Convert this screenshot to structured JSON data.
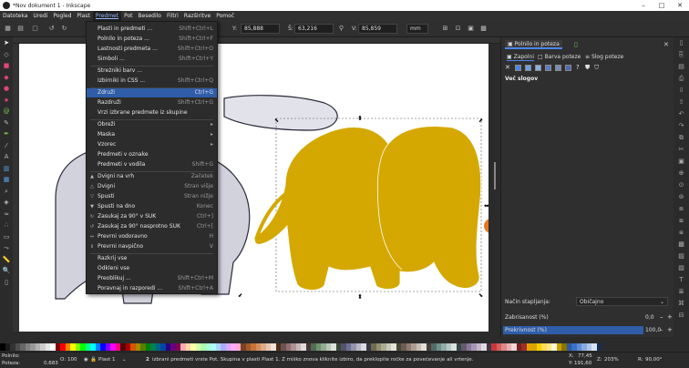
{
  "window": {
    "title": "*Nov dokument 1 - Inkscape",
    "minimize": "–",
    "maximize": "□",
    "close": "✕"
  },
  "menubar": [
    "Datoteka",
    "Uredi",
    "Pogled",
    "Plast",
    "Predmet",
    "Pot",
    "Besedilo",
    "Filtri",
    "Razširitve",
    "Pomoč"
  ],
  "toolbar": {
    "y_label": "Y:",
    "y_value": "85,888",
    "w_label": "Š:",
    "w_value": "63,216",
    "h_label": "V:",
    "h_value": "85,859",
    "unit": "mm"
  },
  "object_menu": [
    {
      "label": "Plasti in predmeti ...",
      "shortcut": "Shift+Ctrl+L"
    },
    {
      "label": "Polnilo in poteza ...",
      "shortcut": "Shift+Ctrl+F"
    },
    {
      "label": "Lastnosti predmeta ...",
      "shortcut": "Shift+Ctrl+O"
    },
    {
      "label": "Simboli ...",
      "shortcut": "Shift+Ctrl+Y"
    },
    {
      "label": "Streżniki barv ...",
      "shortcut": ""
    },
    {
      "label": "Izbirniki in CSS ...",
      "shortcut": "Shift+Ctrl+Q"
    },
    {
      "label": "Združi",
      "shortcut": "Ctrl+G",
      "highlight": true
    },
    {
      "label": "Razdruži",
      "shortcut": "Shift+Ctrl+G"
    },
    {
      "label": "Vrzi izbrane predmete iz skupine",
      "shortcut": ""
    },
    {
      "label": "Obreži",
      "shortcut": "",
      "submenu": true
    },
    {
      "label": "Maska",
      "shortcut": "",
      "submenu": true
    },
    {
      "label": "Vzorec",
      "shortcut": "",
      "submenu": true
    },
    {
      "label": "Predmeti v oznake",
      "shortcut": ""
    },
    {
      "label": "Predmeti v vodila",
      "shortcut": "Shift+G"
    },
    {
      "label": "Dvigni na vrh",
      "shortcut": "Začetek"
    },
    {
      "label": "Dvigni",
      "shortcut": "Stran višje"
    },
    {
      "label": "Spusti",
      "shortcut": "Stran nižje"
    },
    {
      "label": "Spusti na dno",
      "shortcut": "Konec"
    },
    {
      "label": "Zasukaj za 90° v SUK",
      "shortcut": "Ctrl+]"
    },
    {
      "label": "Zasukaj za 90° nasprotno SUK",
      "shortcut": "Ctrl+["
    },
    {
      "label": "Prevrni vodoravno",
      "shortcut": "H"
    },
    {
      "label": "Prevrni navpično",
      "shortcut": "V"
    },
    {
      "label": "Razkrij vse",
      "shortcut": ""
    },
    {
      "label": "Odkleni vse",
      "shortcut": ""
    },
    {
      "label": "Preoblikuj ...",
      "shortcut": "Shift+Ctrl+M"
    },
    {
      "label": "Poravnaj in razporedi ...",
      "shortcut": "Shift+Ctrl+A"
    }
  ],
  "panel": {
    "tab_label": "Polnilo in poteza",
    "subtabs": [
      "Zapolni",
      "Barva poteze",
      "Slog poteze"
    ],
    "no_paint_label": "Več slogov",
    "blend_label": "Način stapljanja:",
    "blend_value": "Običajno",
    "blur_label": "Zabrisanost (%)",
    "blur_value": "0,0",
    "opacity_label": "Prekrivnost (%)",
    "opacity_value": "100,0"
  },
  "status": {
    "fill_label": "Polnilo:",
    "stroke_label": "Poteza:",
    "stroke_width": "0,683",
    "opacity_label": "O:",
    "opacity_value": "100",
    "layer": "Plast 1",
    "message_count": "2",
    "message": "izbrani predmeti vrste Pot. Skupina v plasti Plast 1. Z miško znova kliknite izbiro, da preklopite ročke za povečevanje ali vrtenje.",
    "x_label": "X:",
    "x_value": "77,45",
    "y_label": "Y:",
    "y_value": "191,60",
    "zoom_label": "Z:",
    "zoom_value": "203%",
    "rot_label": "R:",
    "rot_value": "90,00°"
  },
  "colors": {
    "elephant_gold": "#d4a800",
    "elephant_grey": "#d0d0dc",
    "highlight": "#2f5da8",
    "opacity_bar": "#2f5da8"
  }
}
